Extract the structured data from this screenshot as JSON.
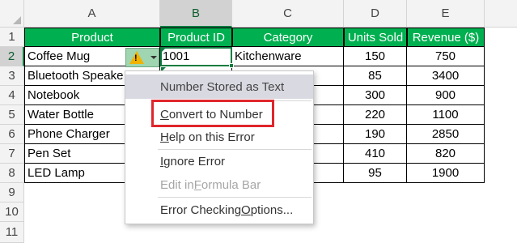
{
  "columns": [
    "A",
    "B",
    "C",
    "D",
    "E"
  ],
  "rows": [
    "1",
    "2",
    "3",
    "4",
    "5",
    "6",
    "7",
    "8",
    "9",
    "10",
    "11"
  ],
  "headers": [
    "Product",
    "Product ID",
    "Category",
    "Units Sold",
    "Revenue ($)"
  ],
  "data": [
    {
      "product": "Coffee Mug",
      "id": "1001",
      "category": "Kitchenware",
      "units": "150",
      "revenue": "750"
    },
    {
      "product": "Bluetooth Speake",
      "id": "",
      "category": "",
      "units": "85",
      "revenue": "3400"
    },
    {
      "product": "Notebook",
      "id": "",
      "category": "",
      "units": "300",
      "revenue": "900"
    },
    {
      "product": "Water Bottle",
      "id": "",
      "category": "",
      "units": "220",
      "revenue": "1100"
    },
    {
      "product": "Phone Charger",
      "id": "",
      "category": "",
      "units": "190",
      "revenue": "2850"
    },
    {
      "product": "Pen Set",
      "id": "",
      "category": "",
      "units": "410",
      "revenue": "820"
    },
    {
      "product": "LED Lamp",
      "id": "",
      "category": "",
      "units": "95",
      "revenue": "1900"
    }
  ],
  "menu": {
    "title": "Number Stored as Text",
    "convert_pre": "",
    "convert_u": "C",
    "convert_post": "onvert to Number",
    "help_pre": "",
    "help_u": "H",
    "help_post": "elp on this Error",
    "ignore_pre": "",
    "ignore_u": "I",
    "ignore_post": "gnore Error",
    "edit_pre": "Edit in ",
    "edit_u": "F",
    "edit_post": "ormula Bar",
    "options_pre": "Error Checking ",
    "options_u": "O",
    "options_post": "ptions..."
  },
  "colors": {
    "header_fill": "#00b050",
    "selection": "#107c41",
    "highlight": "#e0262c",
    "warning": "#f2b200"
  },
  "icons": {
    "error": "warning-triangle-icon"
  }
}
